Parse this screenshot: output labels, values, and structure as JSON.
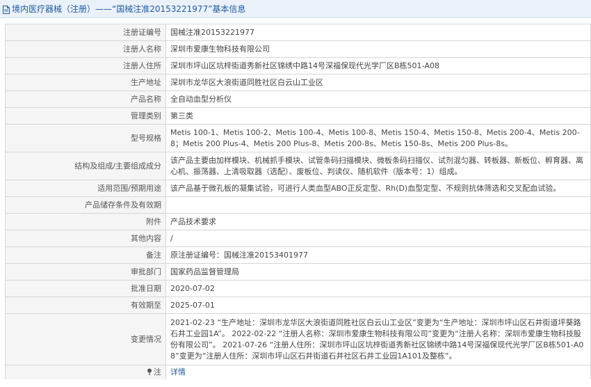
{
  "page_title": "境内医疗器械（注册）——“国械注准20153221977”基本信息",
  "rows": [
    {
      "label": "注册证编号",
      "value": "国械注准20153221977"
    },
    {
      "label": "注册人名称",
      "value": "深圳市爱康生物科技有限公司"
    },
    {
      "label": "注册人住所",
      "value": "深圳市坪山区坑梓街道秀新社区锦绣中路14号深福保现代光学厂区B栋501-A08"
    },
    {
      "label": "生产地址",
      "value": "深圳市龙华区大浪街道同胜社区白云山工业区"
    },
    {
      "label": "产品名称",
      "value": "全自动血型分析仪"
    },
    {
      "label": "管理类别",
      "value": "第三类"
    },
    {
      "label": "型号规格",
      "value": "Metis 100-1、Metis 100-2、Metis 100-4、Metis 100-8、Metis 150-4、Metis 150-8、Metis 200-4、Metis 200-8；Metis 200 Plus-4、Metis 200 Plus-8、Metis 200-8s、Metis 150-8s、Metis 200 Plus-8s。"
    },
    {
      "label": "结构及组成/主要组成成分",
      "value": "该产品主要由加样模块、机械抓手模块、试管条码扫描模块、微板条码扫描仪、试剂混匀器、转板器、新板位、孵育器、离心机、振荡器、上清吸取器（选配）、废板位、判读仪、随机软件（版本号：1）组成。"
    },
    {
      "label": "适用范围/预期用途",
      "value": "该产品基于微孔板的凝集试验，可进行人类血型ABO正反定型、Rh(D)血型定型、不规则抗体筛选和交叉配血试验。"
    },
    {
      "label": "产品储存条件及有效期",
      "value": ""
    },
    {
      "label": "附件",
      "value": "产品技术要求"
    },
    {
      "label": "其他内容",
      "value": "/"
    },
    {
      "label": "备注",
      "value": "原注册证编号：国械注准20153401977"
    },
    {
      "label": "审批部门",
      "value": "国家药品监督管理局"
    },
    {
      "label": "批准日期",
      "value": "2020-07-02"
    },
    {
      "label": "有效期至",
      "value": "2025-07-01"
    },
    {
      "label": "变更情况",
      "value": "2021-02-23 “生产地址：深圳市龙华区大浪街道同胜社区白云山工业区”变更为“生产地址：深圳市坪山区石井街道坪葵路石井工业园1A”。 2022-02-22 “注册人名称：深圳市爱康生物科技有限公司”变更为“注册人名称：深圳市爱康生物科技股份有限公司”。 2021-07-26 “注册人住所：深圳市坪山区坑梓街道秀新社区锦绣中路14号深福保现代光学厂区B栋501-A08”变更为“注册人住所：深圳市坪山区石井街道石井社区石井工业园1A101及整栋”。"
    }
  ],
  "note": {
    "label": "注",
    "link": "详情"
  }
}
